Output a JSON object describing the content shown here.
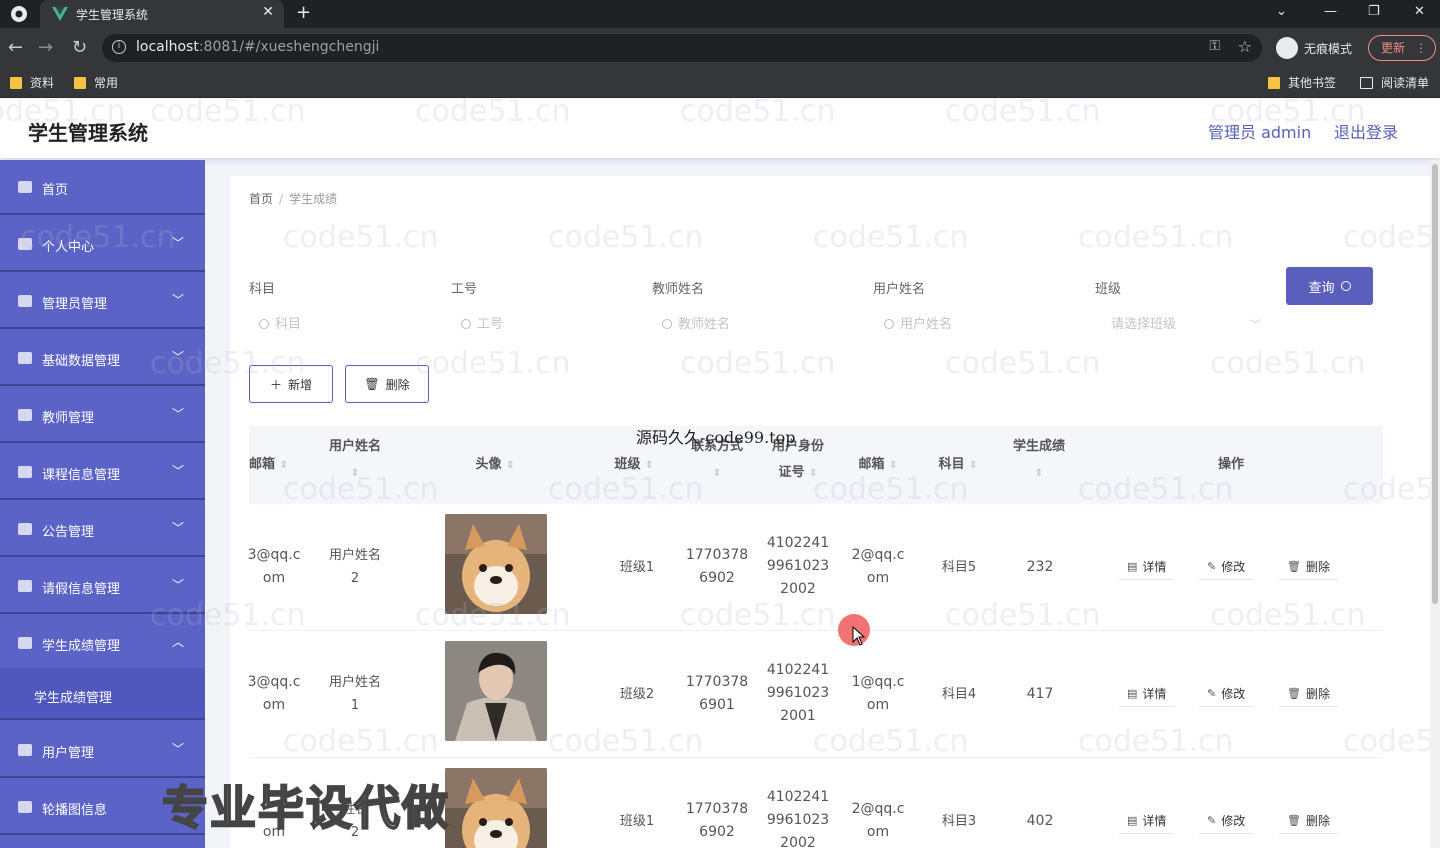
{
  "browser": {
    "tab_title": "学生管理系统",
    "url_host": "localhost",
    "url_rest": ":8081/#/xueshengchengji",
    "incognito_label": "无痕模式",
    "update_label": "更新",
    "bookmarks": [
      "资料",
      "常用",
      "其他书签",
      "阅读清单"
    ]
  },
  "app": {
    "title": "学生管理系统",
    "user_label": "管理员 admin",
    "logout_label": "退出登录"
  },
  "sidebar": {
    "items": [
      {
        "label": "首页"
      },
      {
        "label": "个人中心"
      },
      {
        "label": "管理员管理"
      },
      {
        "label": "基础数据管理"
      },
      {
        "label": "教师管理"
      },
      {
        "label": "课程信息管理"
      },
      {
        "label": "公告管理"
      },
      {
        "label": "请假信息管理"
      },
      {
        "label": "学生成绩管理"
      },
      {
        "label": "学生成绩管理",
        "sub": true
      },
      {
        "label": "用户管理"
      },
      {
        "label": "轮播图信息"
      }
    ]
  },
  "breadcrumb": {
    "home": "首页",
    "sep": "/",
    "current": "学生成绩"
  },
  "filters": {
    "subject_label": "科目",
    "subject_placeholder": "科目",
    "jobno_label": "工号",
    "jobno_placeholder": "工号",
    "teacher_label": "教师姓名",
    "teacher_placeholder": "教师姓名",
    "user_label": "用户姓名",
    "user_placeholder": "用户姓名",
    "class_label": "班级",
    "class_placeholder": "请选择班级",
    "query_label": "查询"
  },
  "actions": {
    "add_label": "新增",
    "delete_label": "删除"
  },
  "table": {
    "headers": {
      "email1": "邮箱",
      "username": "用户姓名",
      "avatar": "头像",
      "class": "班级",
      "phone": "联系方式",
      "idcard_1": "用户身份",
      "idcard_2": "证号",
      "email2": "邮箱",
      "subject": "科目",
      "score": "学生成绩",
      "ops": "操作"
    },
    "row_actions": {
      "detail": "详情",
      "edit": "修改",
      "delete": "删除"
    },
    "rows": [
      {
        "email1_a": "3@qq.c",
        "email1_b": "om",
        "username_a": "用户姓名",
        "username_b": "2",
        "class": "班级1",
        "phone_a": "1770378",
        "phone_b": "6902",
        "id_a": "4102241",
        "id_b": "9961023",
        "id_c": "2002",
        "email2_a": "2@qq.c",
        "email2_b": "om",
        "subject": "科目5",
        "score": "232",
        "avatar": "dog"
      },
      {
        "email1_a": "3@qq.c",
        "email1_b": "om",
        "username_a": "用户姓名",
        "username_b": "1",
        "class": "班级2",
        "phone_a": "1770378",
        "phone_b": "6901",
        "id_a": "4102241",
        "id_b": "9961023",
        "id_c": "2001",
        "email2_a": "1@qq.c",
        "email2_b": "om",
        "subject": "科目4",
        "score": "417",
        "avatar": "person"
      },
      {
        "email1_a": "",
        "email1_b": "om",
        "username_a": "姓名",
        "username_b": "2",
        "class": "班级1",
        "phone_a": "1770378",
        "phone_b": "6902",
        "id_a": "4102241",
        "id_b": "9961023",
        "id_c": "2002",
        "email2_a": "2@qq.c",
        "email2_b": "om",
        "subject": "科目3",
        "score": "402",
        "avatar": "dog"
      }
    ]
  },
  "overlays": {
    "watermark": "code51.cn",
    "center_mark": "源码久久-code99.top",
    "banner": "专业毕设代做"
  },
  "colors": {
    "primary": "#5a5fbe",
    "sidebar": "#5c63c6",
    "header_text": "#5a60b8"
  }
}
